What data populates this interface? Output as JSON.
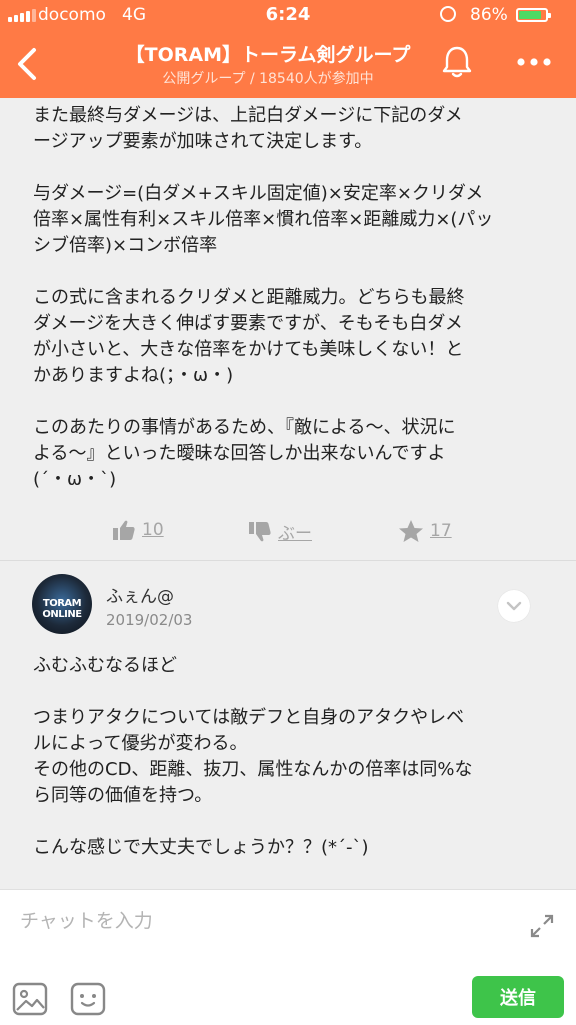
{
  "status_bar": {
    "carrier": "docomo",
    "network": "4G",
    "time": "6:24",
    "battery_percent": "86%",
    "battery_level": 0.86
  },
  "header": {
    "title": "【TORAM】トーラム剣グループ",
    "subtitle": "公開グループ / 18540人が参加中",
    "back_icon": "chevron-left-icon",
    "bell_icon": "bell-icon",
    "more_icon": "more-dots-icon"
  },
  "previous_message": {
    "paragraphs": [
      "また最終与ダメージは、上記白ダメージに下記のダメ\nージアップ要素が加味されて決定します。",
      "与ダメージ=(白ダメ+スキル固定値)×安定率×クリダメ\n倍率×属性有利×スキル倍率×慣れ倍率×距離威力×(パッ\nシブ倍率)×コンボ倍率",
      "この式に含まれるクリダメと距離威力。どちらも最終\nダメージを大きく伸ばす要素ですが、そもそも白ダメ\nが小さいと、大きな倍率をかけても美味しくない！と\nかありますよね(；・ω・)",
      "このあたりの事情があるため、『敵による〜、状況に\nよる〜』といった曖昧な回答しか出来ないんですよ\n(´・ω・`)"
    ],
    "reactions": {
      "like_count": "10",
      "dislike_label": "ぶー",
      "favorite_count": "17"
    }
  },
  "reply": {
    "author": "ふぇん@",
    "date": "2019/02/03",
    "avatar_text": "TORAM ONLINE",
    "text": "ふむふむなるほど\n\nつまりアタクについては敵デフと自身のアタクやレベ\nルによって優劣が変わる。\nその他のCD、距離、抜刀、属性なんかの倍率は同%な\nら同等の価値を持つ。\n\nこんな感じで大丈夫でしょうか？？(*´-`)"
  },
  "composer": {
    "placeholder": "チャットを入力",
    "send_label": "送信"
  },
  "colors": {
    "header": "#ff7a45",
    "send": "#3ec44a",
    "reaction": "#a6a6a6"
  }
}
